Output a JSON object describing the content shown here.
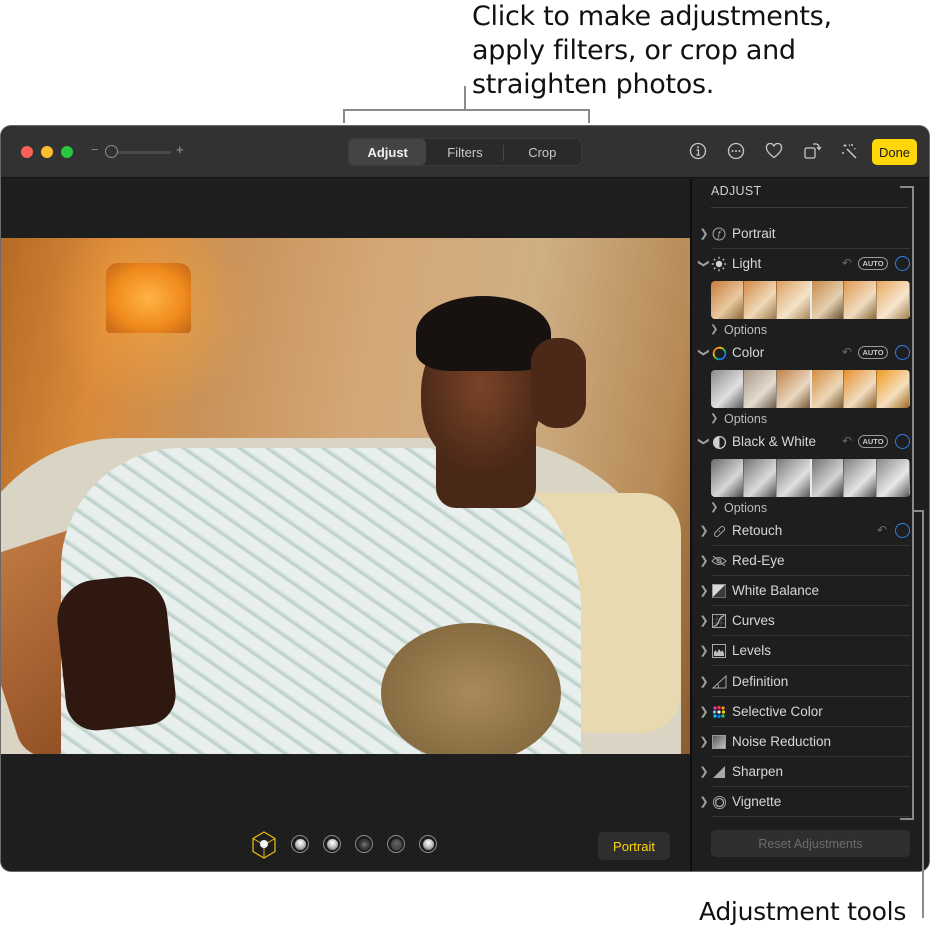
{
  "callouts": {
    "top_lines": [
      "Click to make adjustments,",
      "apply filters, or crop and",
      "straighten photos."
    ],
    "bottom": "Adjustment tools"
  },
  "toolbar": {
    "zoom_minus": "−",
    "zoom_plus": "+",
    "zoom_level": 0.1,
    "tabs": [
      {
        "label": "Adjust",
        "active": true
      },
      {
        "label": "Filters",
        "active": false
      },
      {
        "label": "Crop",
        "active": false
      }
    ],
    "icons": [
      "info-icon",
      "more-icon",
      "favorite-heart-icon",
      "rotate-icon",
      "auto-enhance-icon"
    ],
    "done_label": "Done"
  },
  "photo": {
    "light_presets": [
      "natural-light",
      "studio-light",
      "contour-light",
      "stage-light",
      "stage-light-mono",
      "high-key-light-mono"
    ],
    "portrait_label": "Portrait"
  },
  "sidebar": {
    "header": "ADJUST",
    "portrait": {
      "label": "Portrait"
    },
    "light": {
      "label": "Light",
      "auto": "AUTO",
      "options": "Options"
    },
    "color": {
      "label": "Color",
      "auto": "AUTO",
      "options": "Options"
    },
    "bw": {
      "label": "Black & White",
      "auto": "AUTO",
      "options": "Options"
    },
    "tools": [
      {
        "label": "Retouch",
        "icon": "bandage-icon"
      },
      {
        "label": "Red-Eye",
        "icon": "red-eye-icon"
      },
      {
        "label": "White Balance",
        "icon": "white-balance-icon"
      },
      {
        "label": "Curves",
        "icon": "curves-icon"
      },
      {
        "label": "Levels",
        "icon": "levels-icon"
      },
      {
        "label": "Definition",
        "icon": "definition-icon"
      },
      {
        "label": "Selective Color",
        "icon": "selective-color-icon"
      },
      {
        "label": "Noise Reduction",
        "icon": "noise-reduction-icon"
      },
      {
        "label": "Sharpen",
        "icon": "sharpen-icon"
      },
      {
        "label": "Vignette",
        "icon": "vignette-icon"
      }
    ],
    "reset_label": "Reset Adjustments",
    "colors": {
      "accent_blue": "#2f7fe6",
      "done_yellow": "#ffd60a"
    }
  }
}
